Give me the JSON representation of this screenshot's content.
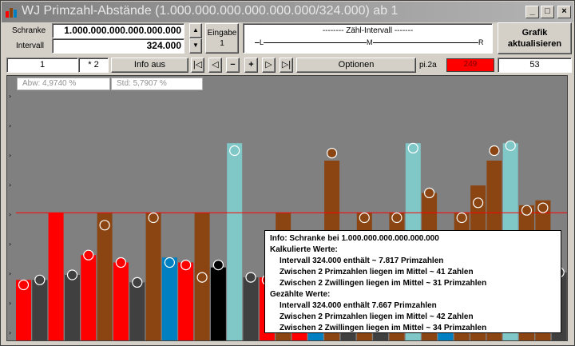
{
  "window": {
    "title": "WJ Primzahl-Abstände (1.000.000.000.000.000.000/324.000) ab 1",
    "minimize_glyph": "_",
    "maximize_glyph": "□",
    "close_glyph": "×"
  },
  "controls": {
    "schranke_label": "Schranke",
    "schranke_value": "1.000.000.000.000.000.000",
    "intervall_label": "Intervall",
    "intervall_value": "324.000",
    "eingabe_label": "Eingabe",
    "eingabe_value": "1",
    "zaehl_intervall_title": "-------- Zähl-Intervall -------",
    "marker_l": "L",
    "marker_m": "M",
    "marker_r": "R",
    "grafik_label_1": "Grafik",
    "grafik_label_2": "aktualisieren"
  },
  "toolbar": {
    "page_value": "1",
    "multiplier": "* 2",
    "info_button": "Info aus",
    "optionen_button": "Optionen",
    "pi_label": "pi.2a",
    "pi_value": "249",
    "count_value": "53"
  },
  "stats": {
    "abw": "Abw: 4,9740 %",
    "std": "Std: 5,7907 %"
  },
  "info": {
    "line0": "Info:  Schranke bei 1.000.000.000.000.000.000",
    "line1": "Kalkulierte Werte:",
    "line2": "Intervall 324.000 enthält ~ 7.817 Primzahlen",
    "line3": "Zwischen 2 Primzahlen liegen im Mittel ~ 41 Zahlen",
    "line4": "Zwischen 2 Zwillingen liegen im Mittel ~ 31 Primzahlen",
    "line5": "Gezählte Werte:",
    "line6": "Intervall 324.000 enthält 7.667 Primzahlen",
    "line7": "Zwischen 2 Primzahlen liegen im Mittel ~ 42 Zahlen",
    "line8": "Zwischen 2 Zwillingen liegen im Mittel ~ 34 Primzahlen"
  },
  "colors": {
    "red": "#ff0000",
    "brown": "#8b4513",
    "dark": "#404040",
    "lightblue": "#80c8c8",
    "blue": "#0080c0",
    "black": "#000000",
    "bg": "#808080"
  },
  "chart_data": {
    "type": "bar",
    "bars": [
      {
        "color": "red",
        "value": 25,
        "circle": 23
      },
      {
        "color": "dark",
        "value": 25,
        "circle": 25
      },
      {
        "color": "red",
        "value": 52,
        "circle": null
      },
      {
        "color": "dark",
        "value": 27,
        "circle": 27
      },
      {
        "color": "red",
        "value": 35,
        "circle": 35
      },
      {
        "color": "brown",
        "value": 52,
        "circle": 47
      },
      {
        "color": "red",
        "value": 32,
        "circle": 32
      },
      {
        "color": "dark",
        "value": 24,
        "circle": 24
      },
      {
        "color": "brown",
        "value": 52,
        "circle": 50
      },
      {
        "color": "blue",
        "value": 34,
        "circle": 32
      },
      {
        "color": "red",
        "value": 32,
        "circle": 31
      },
      {
        "color": "brown",
        "value": 52,
        "circle": 26
      },
      {
        "color": "black",
        "value": 30,
        "circle": 31
      },
      {
        "color": "lightblue",
        "value": 80,
        "circle": 77
      },
      {
        "color": "dark",
        "value": 26,
        "circle": 26
      },
      {
        "color": "red",
        "value": 26,
        "circle": 25
      },
      {
        "color": "brown",
        "value": 52,
        "circle": null
      },
      {
        "color": "red",
        "value": 27,
        "circle": 27
      },
      {
        "color": "blue",
        "value": 33,
        "circle": 33
      },
      {
        "color": "brown",
        "value": 73,
        "circle": 76
      },
      {
        "color": "dark",
        "value": 27,
        "circle": null
      },
      {
        "color": "brown",
        "value": 52,
        "circle": 50
      },
      {
        "color": "dark",
        "value": 20,
        "circle": null
      },
      {
        "color": "brown",
        "value": 52,
        "circle": 50
      },
      {
        "color": "lightblue",
        "value": 80,
        "circle": 78
      },
      {
        "color": "brown",
        "value": 60,
        "circle": 60
      },
      {
        "color": "blue",
        "value": 42,
        "circle": 42
      },
      {
        "color": "brown",
        "value": 52,
        "circle": 50
      },
      {
        "color": "brown",
        "value": 63,
        "circle": 56
      },
      {
        "color": "brown",
        "value": 73,
        "circle": 77
      },
      {
        "color": "lightblue",
        "value": 80,
        "circle": 79
      },
      {
        "color": "brown",
        "value": 55,
        "circle": 53
      },
      {
        "color": "brown",
        "value": 57,
        "circle": 54
      },
      {
        "color": "dark",
        "value": 28,
        "circle": 28
      }
    ],
    "reference_line": 52,
    "ylim": [
      0,
      100
    ]
  }
}
